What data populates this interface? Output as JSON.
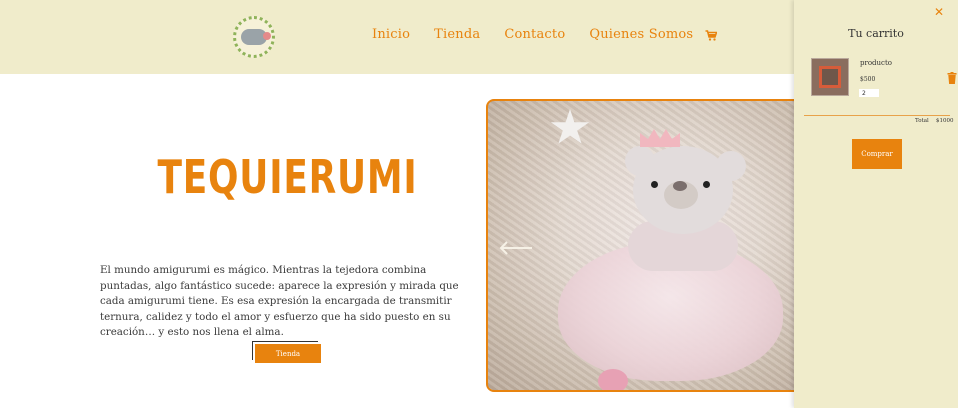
{
  "nav": {
    "links": [
      "Inicio",
      "Tienda",
      "Contacto",
      "Quienes Somos"
    ],
    "logo_icon": "elephant-logo",
    "cart_icon": "shopping-cart-icon"
  },
  "hero": {
    "title": "TEQUIERUMI",
    "description": "El mundo amigurumi es mágico. Mientras la tejedora combina puntadas, algo fantástico sucede: aparece la expresión y mirada que cada amigurumi tiene. Es esa expresión la encargada de transmitir ternura, calidez y todo el amor y esfuerzo que ha sido puesto en su creación… y esto nos llena el alma.",
    "button_label": "Tienda"
  },
  "carousel": {
    "prev_icon": "arrow-left-icon"
  },
  "cart": {
    "close_icon": "close-icon",
    "title": "Tu carrito",
    "item": {
      "name": "producto",
      "price": "$500",
      "quantity": "2",
      "remove_icon": "trash-icon"
    },
    "total_label": "Total",
    "total_value": "$1000",
    "checkout_label": "Comprar"
  },
  "colors": {
    "accent": "#e8830e",
    "nav_bg": "#f0eccb",
    "text": "#3a3a3a"
  }
}
